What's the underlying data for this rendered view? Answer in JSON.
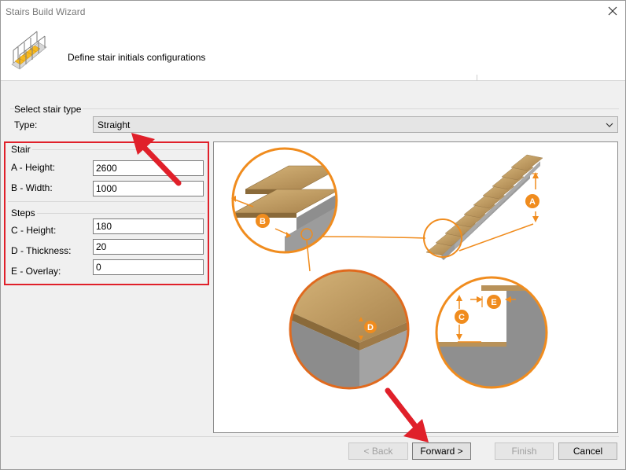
{
  "window": {
    "title": "Stairs Build Wizard"
  },
  "header": {
    "subtitle": "Define stair initials configurations"
  },
  "stair_type": {
    "group_title": "Select stair type",
    "type_label": "Type:",
    "type_value": "Straight"
  },
  "stair": {
    "section_title": "Stair",
    "height_label": "A - Height:",
    "height_value": "2600",
    "width_label": "B - Width:",
    "width_value": "1000"
  },
  "steps": {
    "section_title": "Steps",
    "height_label": "C - Height:",
    "height_value": "180",
    "thickness_label": "D - Thickness:",
    "thickness_value": "20",
    "overlay_label": "E - Overlay:",
    "overlay_value": "0"
  },
  "preview": {
    "marker_a": "A",
    "marker_b": "B",
    "marker_c": "C",
    "marker_d": "D",
    "marker_e": "E"
  },
  "buttons": {
    "back": "< Back",
    "forward": "Forward >",
    "finish": "Finish",
    "cancel": "Cancel"
  },
  "colors": {
    "accent_orange": "#f08c1e",
    "annotation_red": "#e0202a",
    "wood": "#b8925a"
  }
}
